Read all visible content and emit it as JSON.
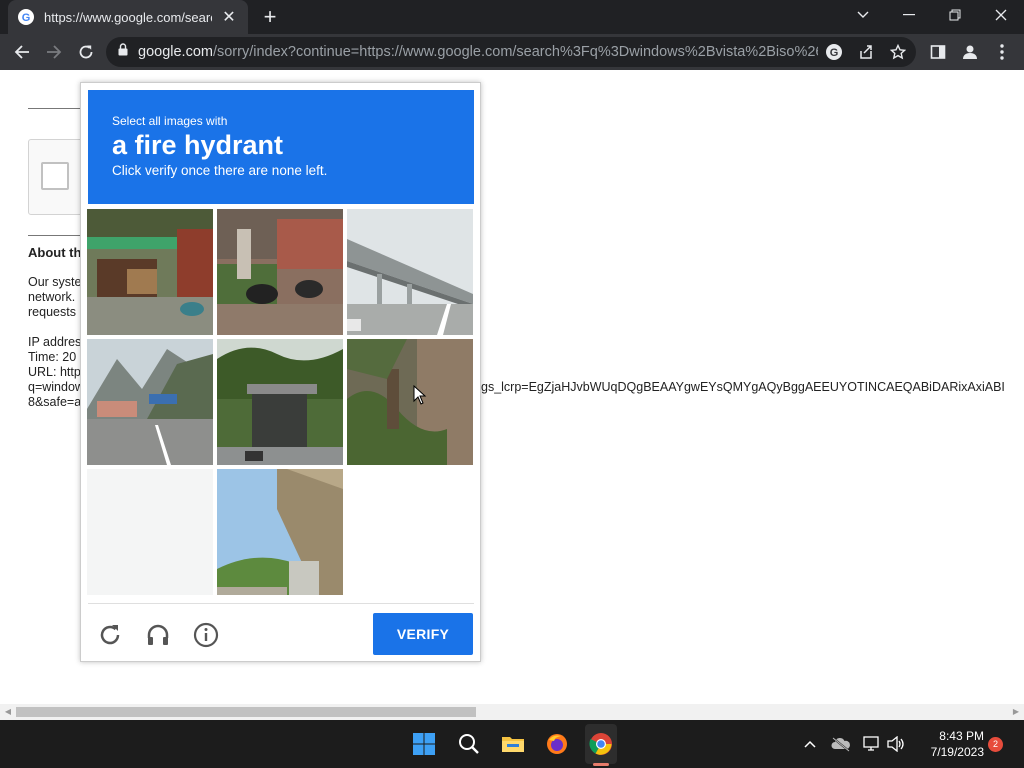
{
  "browser": {
    "tab_title": "https://www.google.com/search?",
    "tab_close": "✕",
    "new_tab": "+",
    "url_host": "google.com",
    "url_path": "/sorry/index?continue=https://www.google.com/search%3Fq%3Dwindows%2Bvista%2Biso%26..."
  },
  "page": {
    "about_title": "About th",
    "lines": [
      "Our syste",
      "network.",
      "requests",
      "IP addres",
      "Time: 20",
      "URL: http",
      "q=window",
      "8&safe=a"
    ],
    "url_tail": "gs_lcrp=EgZjaHJvbWUqDQgBEAAYgwEYsQMYgAQyBggAEEUYOTINCAEQABiDARixAxiABI"
  },
  "captcha": {
    "subtitle": "Select all images with",
    "target": "a fire hydrant",
    "instruction": "Click verify once there are none left.",
    "verify_label": "VERIFY",
    "tiles": [
      "market-stall",
      "motorbikes-street",
      "highway-overpass",
      "mountain-road",
      "tunnel-road",
      "roadside-vegetation",
      "empty-loading",
      "bridge-underside",
      "empty-loading"
    ]
  },
  "taskbar": {
    "time": "8:43 PM",
    "date": "7/19/2023",
    "notifications": "2"
  },
  "colors": {
    "accent": "#1a73e8",
    "chrome_dark": "#202124",
    "chrome_toolbar": "#35363a"
  }
}
